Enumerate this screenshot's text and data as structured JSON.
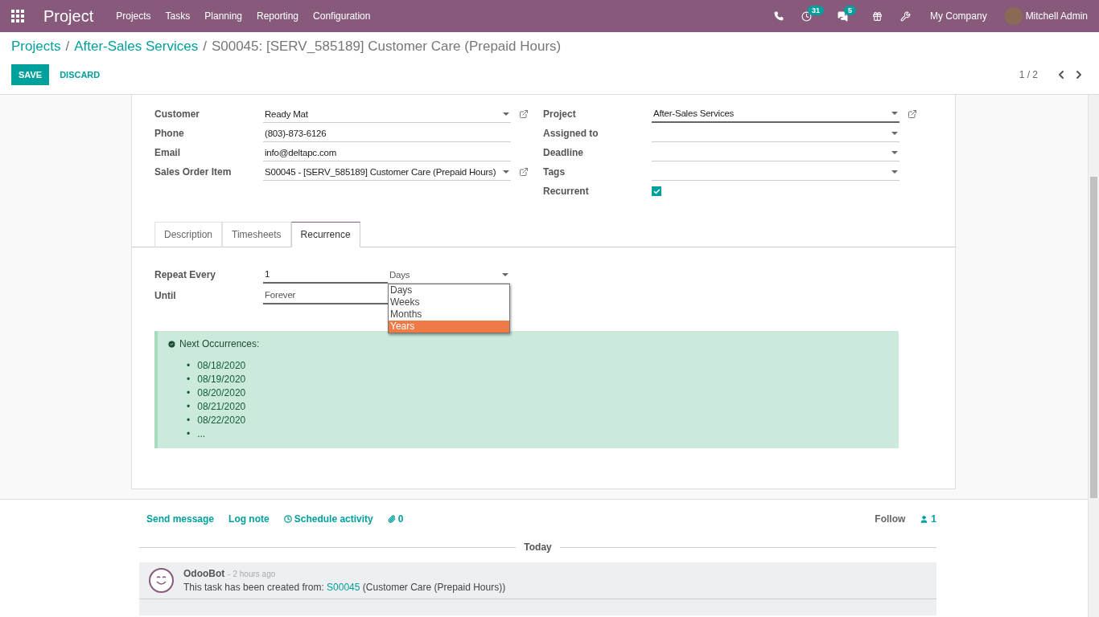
{
  "navbar": {
    "app_name": "Project",
    "menu": [
      "Projects",
      "Tasks",
      "Planning",
      "Reporting",
      "Configuration"
    ],
    "activity_count": "31",
    "message_count": "5",
    "company": "My Company",
    "user": "Mitchell Admin"
  },
  "breadcrumbs": [
    "Projects",
    "After-Sales Services",
    "S00045: [SERV_585189] Customer Care (Prepaid Hours)"
  ],
  "breadcrumb_separator": "/",
  "bullet": "•",
  "buttons": {
    "save": "SAVE",
    "discard": "DISCARD"
  },
  "pager": "1 / 2",
  "left_fields": [
    {
      "label": "Customer",
      "value": "Ready Mat",
      "kind": "many2one",
      "focused": false
    },
    {
      "label": "Phone",
      "value": "(803)-873-6126",
      "kind": "char",
      "focused": false
    },
    {
      "label": "Email",
      "value": "info@deltapc.com",
      "kind": "char",
      "focused": false
    },
    {
      "label": "Sales Order Item",
      "value": "S00045 - [SERV_585189] Customer Care (Prepaid Hours)",
      "kind": "many2one",
      "focused": false
    }
  ],
  "right_fields": [
    {
      "label": "Project",
      "value": "After-Sales Services",
      "kind": "many2one",
      "focused": true
    },
    {
      "label": "Assigned to",
      "kind": "select",
      "focused": false
    },
    {
      "label": "Deadline",
      "kind": "select",
      "focused": false
    },
    {
      "label": "Tags",
      "kind": "select",
      "focused": false
    },
    {
      "label": "Recurrent",
      "kind": "checkbox",
      "checked": true
    }
  ],
  "tabs": [
    {
      "label": "Description",
      "selected": false
    },
    {
      "label": "Timesheets",
      "selected": false
    },
    {
      "label": "Recurrence",
      "selected": true
    }
  ],
  "recurrence": {
    "repeat_label": "Repeat Every",
    "repeat_value": "1",
    "unit": "Days",
    "until_label": "Until",
    "until_value": "Forever",
    "unit_options": [
      {
        "label": "Days",
        "selected": false
      },
      {
        "label": "Weeks",
        "selected": false
      },
      {
        "label": "Months",
        "selected": false
      },
      {
        "label": "Years",
        "selected": true
      }
    ]
  },
  "next_occurrences": {
    "title": "Next Occurrences:",
    "dates": [
      "08/18/2020",
      "08/19/2020",
      "08/20/2020",
      "08/21/2020",
      "08/22/2020",
      "..."
    ]
  },
  "chatter": {
    "actions": [
      "Send message",
      "Log note",
      "Schedule activity"
    ],
    "attachments": "0",
    "follow": "Follow",
    "followers": "1",
    "separator": "Today",
    "messages": [
      {
        "author": "OdooBot",
        "time": "- 2 hours ago",
        "body_before": "This task has been created from: ",
        "link": "S00045",
        "body_after": " (Customer Care (Prepaid Hours))"
      }
    ]
  }
}
